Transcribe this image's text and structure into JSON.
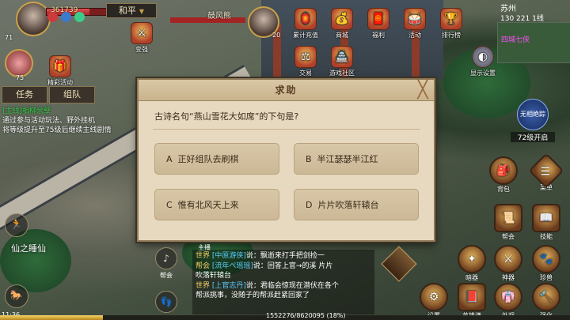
{
  "player": {
    "level": "71",
    "hp_text": "361739",
    "hp_fill": 0.72,
    "pet_level": "75"
  },
  "pk_mode": {
    "label": "和平",
    "arrow": "▼"
  },
  "target": {
    "name": "鼓风熊",
    "level": "20",
    "hp_fill": 1.0
  },
  "left_features": {
    "bianqiang": "变强",
    "jingcai": "精彩活动"
  },
  "top_icons": [
    {
      "label": "累计充值",
      "icon": "🏮"
    },
    {
      "label": "商城",
      "icon": "💰"
    },
    {
      "label": "福利",
      "icon": "🧧"
    },
    {
      "label": "活动",
      "icon": "🥁"
    },
    {
      "label": "排行榜",
      "icon": "🏆"
    },
    {
      "label": "交易",
      "icon": "⚖"
    },
    {
      "label": "游戏社区",
      "icon": "🏯"
    }
  ],
  "tabs": {
    "task": "任务",
    "team": "组队"
  },
  "quest": {
    "title": "[主线]相柳余孽",
    "line1": "通过参与活动玩法、野外挂机",
    "line2": "将等级提升至75级后继续主线剧情"
  },
  "map": {
    "name": "苏州",
    "coords": "130 221",
    "line": "1线",
    "minimap_label": "四城七侠"
  },
  "display_settings": "显示设置",
  "new_open": {
    "title": "无相绝踪",
    "sub": "72级开启"
  },
  "dialog": {
    "title": "求助",
    "close": "╳",
    "question": "古诗名句“燕山雪花大如席”的下句是?",
    "options": [
      {
        "key": "A",
        "text": "正好组队去刷棋"
      },
      {
        "key": "B",
        "text": "半江瑟瑟半江红"
      },
      {
        "key": "C",
        "text": "惟有北风天上来"
      },
      {
        "key": "D",
        "text": "片片吹落轩辕台"
      }
    ]
  },
  "bottom_left": {
    "name": "仙之睡仙",
    "time": "11:36"
  },
  "chat_side": {
    "team_label": "帮会",
    "main_label": "主播"
  },
  "chat": [
    {
      "channel": "世界",
      "sender": "[中原游侠]",
      "text": "说：飘逝来打手把剑捡一"
    },
    {
      "channel": "帮会",
      "sender": "[流年ぺ瑶瑶]",
      "text": "说：回答上官→的溪 片片"
    },
    {
      "channel": "",
      "sender": "",
      "text": "吹落轩辕台"
    },
    {
      "channel": "世界",
      "sender": "[上官志丹]",
      "text": "说：君临会惊现在潜伏在各个"
    },
    {
      "channel": "",
      "sender": "",
      "text": "帮派挑事，没随子的帮派赶紧回家了"
    }
  ],
  "exp": {
    "text": "1552276/8620095 (18%)",
    "fraction": 0.18
  },
  "right_skills": [
    {
      "label": "背包",
      "icon": "🎒"
    },
    {
      "label": "菜单",
      "icon": "☰"
    },
    {
      "label": "帮会",
      "icon": "📜"
    },
    {
      "label": "技能",
      "icon": "📖"
    },
    {
      "label": "暗器",
      "icon": "✦"
    },
    {
      "label": "神器",
      "icon": "⚔"
    },
    {
      "label": "珍兽",
      "icon": "🐾"
    },
    {
      "label": "设置",
      "icon": "⚙"
    },
    {
      "label": "英雄谱",
      "icon": "📕"
    },
    {
      "label": "外观",
      "icon": "👘"
    },
    {
      "label": "强化",
      "icon": "🔨"
    }
  ]
}
